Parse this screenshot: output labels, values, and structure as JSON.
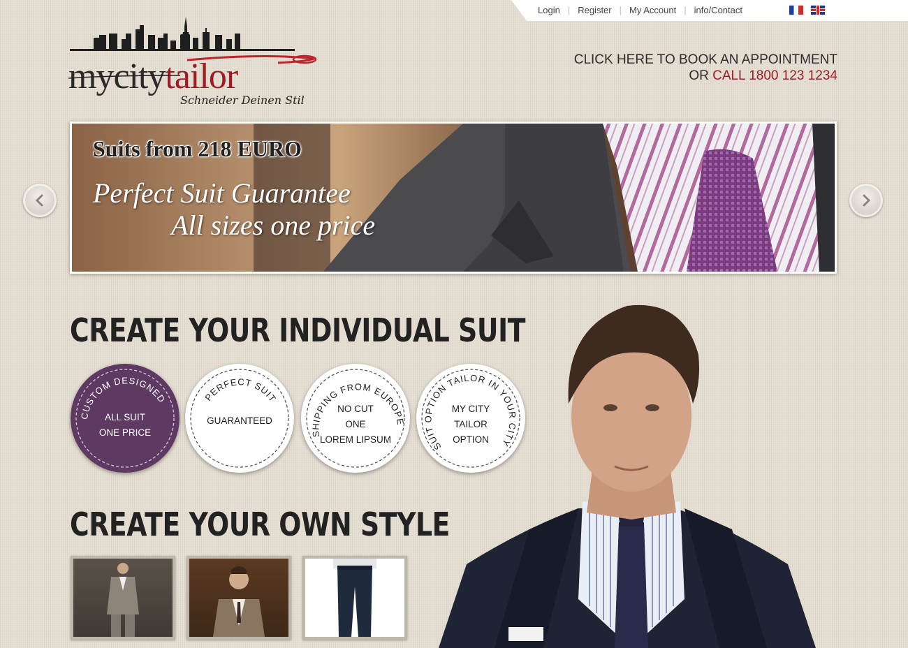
{
  "topbar": {
    "links": [
      "Login",
      "Register",
      "My Account",
      "info/Contact"
    ],
    "languages": [
      "French",
      "English"
    ]
  },
  "logo": {
    "name_part1": "mycity",
    "name_part2": "tailor",
    "tagline": "Schneider Deinen Stil"
  },
  "appointment": {
    "line1": "CLICK HERE TO BOOK AN APPOINTMENT",
    "line2_prefix": "OR ",
    "line2_call": "CALL 1800 123 1234"
  },
  "banner": {
    "title": "Suits from 218 EURO",
    "line1": "Perfect Suit Guarantee",
    "line2": "All sizes one price"
  },
  "sections": {
    "individual_suit": "CREATE YOUR INDIVIDUAL SUIT",
    "own_style": "CREATE YOUR OWN STYLE"
  },
  "badges": [
    {
      "arc": "CUSTOM DESIGNED",
      "center": [
        "ALL SUIT",
        "ONE PRICE"
      ]
    },
    {
      "arc": "PERFECT SUIT",
      "center": [
        "GUARANTEED"
      ]
    },
    {
      "arc": "SHIPPING FROM EUROPE",
      "center": [
        "NO CUT",
        "ONE",
        "LOREM LIPSUM"
      ]
    },
    {
      "arc": "SUIT OPTION TAILOR IN YOUR CITY",
      "center": [
        "MY CITY",
        "TAILOR",
        "OPTION"
      ]
    }
  ],
  "colors": {
    "brand_red": "#9c1d25",
    "badge_purple": "#5e3a63",
    "background": "#e4ddd1"
  }
}
